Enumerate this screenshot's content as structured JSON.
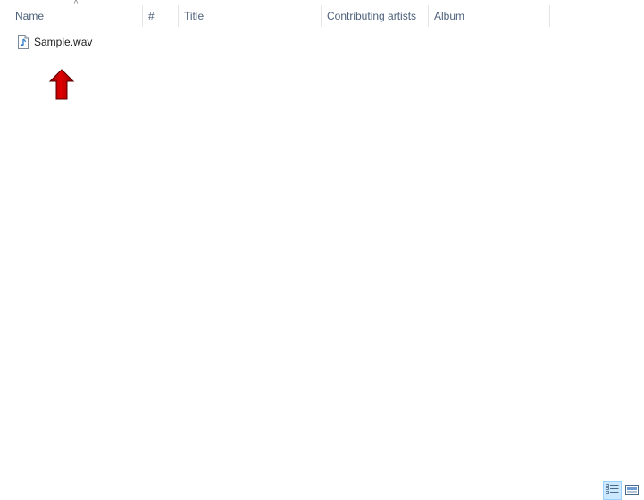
{
  "columns": [
    {
      "label": "Name"
    },
    {
      "label": "#"
    },
    {
      "label": "Title"
    },
    {
      "label": "Contributing artists"
    },
    {
      "label": "Album"
    }
  ],
  "sort_indicator": "^",
  "files": [
    {
      "name": "Sample.wav",
      "icon": "audio-file-icon"
    }
  ],
  "status_bar": {
    "views": [
      {
        "name": "details-view",
        "active": true
      },
      {
        "name": "large-icons-view",
        "active": false
      }
    ]
  },
  "colors": {
    "header_text": "#4c607a",
    "annotation_arrow": "#d40000",
    "active_view_bg": "#cce8ff"
  }
}
